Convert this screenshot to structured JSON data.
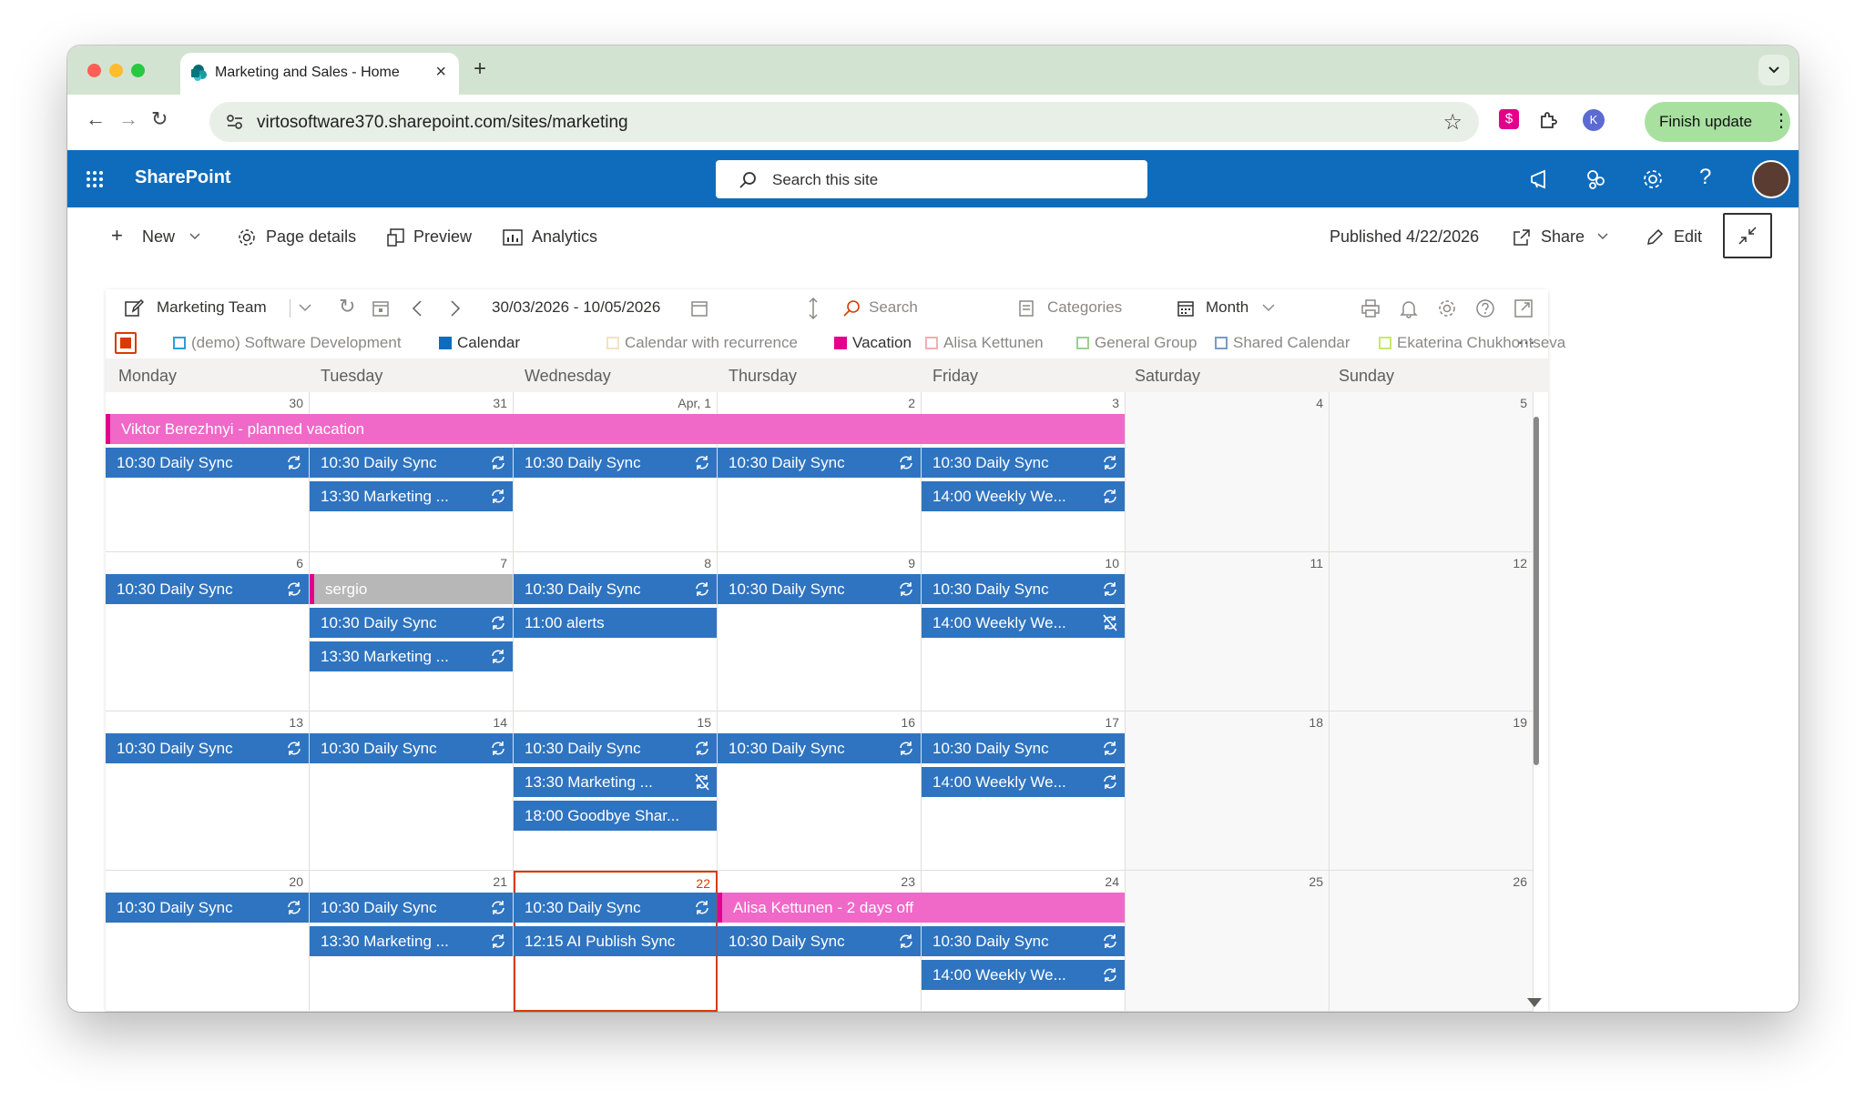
{
  "browser": {
    "tab_title": "Marketing and Sales - Home",
    "url": "virtosoftware370.sharepoint.com/sites/marketing",
    "finish_update": "Finish update",
    "profile_initial": "K"
  },
  "sharepoint": {
    "app_title": "SharePoint",
    "search_placeholder": "Search this site"
  },
  "commandbar": {
    "new": "New",
    "page_details": "Page details",
    "preview": "Preview",
    "analytics": "Analytics",
    "published": "Published 4/22/2026",
    "share": "Share",
    "edit": "Edit"
  },
  "calendar": {
    "name": "Marketing Team",
    "date_range": "30/03/2026 - 10/05/2026",
    "search": "Search",
    "categories": "Categories",
    "view": "Month",
    "legend": [
      {
        "label": "(demo) Software Development",
        "color": "#2aa0d8",
        "filled": false
      },
      {
        "label": "Calendar",
        "color": "#0f6cbd",
        "filled": true
      },
      {
        "label": "Calendar with recurrence",
        "color": "#f3e3c2",
        "filled": false
      },
      {
        "label": "Vacation",
        "color": "#e3008c",
        "filled": true
      },
      {
        "label": "Alisa Kettunen",
        "color": "#f0b0b0",
        "filled": false
      },
      {
        "label": "General Group",
        "color": "#9bd08f",
        "filled": false
      },
      {
        "label": "Shared Calendar",
        "color": "#7a9cc6",
        "filled": false
      },
      {
        "label": "Ekaterina Chukhontseva",
        "color": "#c6e86c",
        "filled": false
      }
    ],
    "days": [
      "Monday",
      "Tuesday",
      "Wednesday",
      "Thursday",
      "Friday",
      "Saturday",
      "Sunday"
    ],
    "weeks": [
      {
        "dates": [
          "30",
          "31",
          "Apr, 1",
          "2",
          "3",
          "4",
          "5"
        ],
        "bars": [
          {
            "text": "Viktor Berezhnyi - planned vacation",
            "start": 0,
            "span": 5,
            "row": 0
          }
        ],
        "events": [
          {
            "day": 0,
            "row": 1,
            "text": "10:30 Daily Sync",
            "icon": "recur"
          },
          {
            "day": 1,
            "row": 1,
            "text": "10:30 Daily Sync",
            "icon": "recur"
          },
          {
            "day": 1,
            "row": 2,
            "text": "13:30 Marketing ...",
            "icon": "recur"
          },
          {
            "day": 2,
            "row": 1,
            "text": "10:30 Daily Sync",
            "icon": "recur"
          },
          {
            "day": 3,
            "row": 1,
            "text": "10:30 Daily Sync",
            "icon": "recur"
          },
          {
            "day": 4,
            "row": 1,
            "text": "10:30 Daily Sync",
            "icon": "recur"
          },
          {
            "day": 4,
            "row": 2,
            "text": "14:00 Weekly We...",
            "icon": "recur"
          }
        ]
      },
      {
        "dates": [
          "6",
          "7",
          "8",
          "9",
          "10",
          "11",
          "12"
        ],
        "bars": [],
        "events": [
          {
            "day": 0,
            "row": 0,
            "text": "10:30 Daily Sync",
            "icon": "recur"
          },
          {
            "day": 1,
            "row": 0,
            "text": "sergio",
            "icon": "none",
            "style": "grey"
          },
          {
            "day": 1,
            "row": 1,
            "text": "10:30 Daily Sync",
            "icon": "recur"
          },
          {
            "day": 1,
            "row": 2,
            "text": "13:30 Marketing ...",
            "icon": "recur"
          },
          {
            "day": 2,
            "row": 0,
            "text": "10:30 Daily Sync",
            "icon": "recur"
          },
          {
            "day": 2,
            "row": 1,
            "text": "11:00 alerts",
            "icon": "none"
          },
          {
            "day": 3,
            "row": 0,
            "text": "10:30 Daily Sync",
            "icon": "recur"
          },
          {
            "day": 4,
            "row": 0,
            "text": "10:30 Daily Sync",
            "icon": "recur"
          },
          {
            "day": 4,
            "row": 1,
            "text": "14:00 Weekly We...",
            "icon": "recur-off"
          }
        ]
      },
      {
        "dates": [
          "13",
          "14",
          "15",
          "16",
          "17",
          "18",
          "19"
        ],
        "bars": [],
        "events": [
          {
            "day": 0,
            "row": 0,
            "text": "10:30 Daily Sync",
            "icon": "recur"
          },
          {
            "day": 1,
            "row": 0,
            "text": "10:30 Daily Sync",
            "icon": "recur"
          },
          {
            "day": 2,
            "row": 0,
            "text": "10:30 Daily Sync",
            "icon": "recur"
          },
          {
            "day": 2,
            "row": 1,
            "text": "13:30 Marketing ...",
            "icon": "recur-off"
          },
          {
            "day": 2,
            "row": 2,
            "text": "18:00 Goodbye Shar...",
            "icon": "none"
          },
          {
            "day": 3,
            "row": 0,
            "text": "10:30 Daily Sync",
            "icon": "recur"
          },
          {
            "day": 4,
            "row": 0,
            "text": "10:30 Daily Sync",
            "icon": "recur"
          },
          {
            "day": 4,
            "row": 1,
            "text": "14:00 Weekly We...",
            "icon": "recur"
          }
        ]
      },
      {
        "dates": [
          "20",
          "21",
          "22",
          "23",
          "24",
          "25",
          "26"
        ],
        "today_index": 2,
        "bars": [
          {
            "text": "Alisa Kettunen - 2 days off",
            "start": 3,
            "span": 2,
            "row": 0
          }
        ],
        "events": [
          {
            "day": 0,
            "row": 0,
            "text": "10:30 Daily Sync",
            "icon": "recur"
          },
          {
            "day": 1,
            "row": 0,
            "text": "10:30 Daily Sync",
            "icon": "recur"
          },
          {
            "day": 1,
            "row": 1,
            "text": "13:30 Marketing ...",
            "icon": "recur"
          },
          {
            "day": 2,
            "row": 0,
            "text": "10:30 Daily Sync",
            "icon": "recur"
          },
          {
            "day": 2,
            "row": 1,
            "text": "12:15 AI Publish Sync",
            "icon": "none"
          },
          {
            "day": 3,
            "row": 1,
            "text": "10:30 Daily Sync",
            "icon": "recur"
          },
          {
            "day": 4,
            "row": 1,
            "text": "10:30 Daily Sync",
            "icon": "recur"
          },
          {
            "day": 4,
            "row": 2,
            "text": "14:00 Weekly We...",
            "icon": "recur"
          }
        ]
      }
    ]
  }
}
